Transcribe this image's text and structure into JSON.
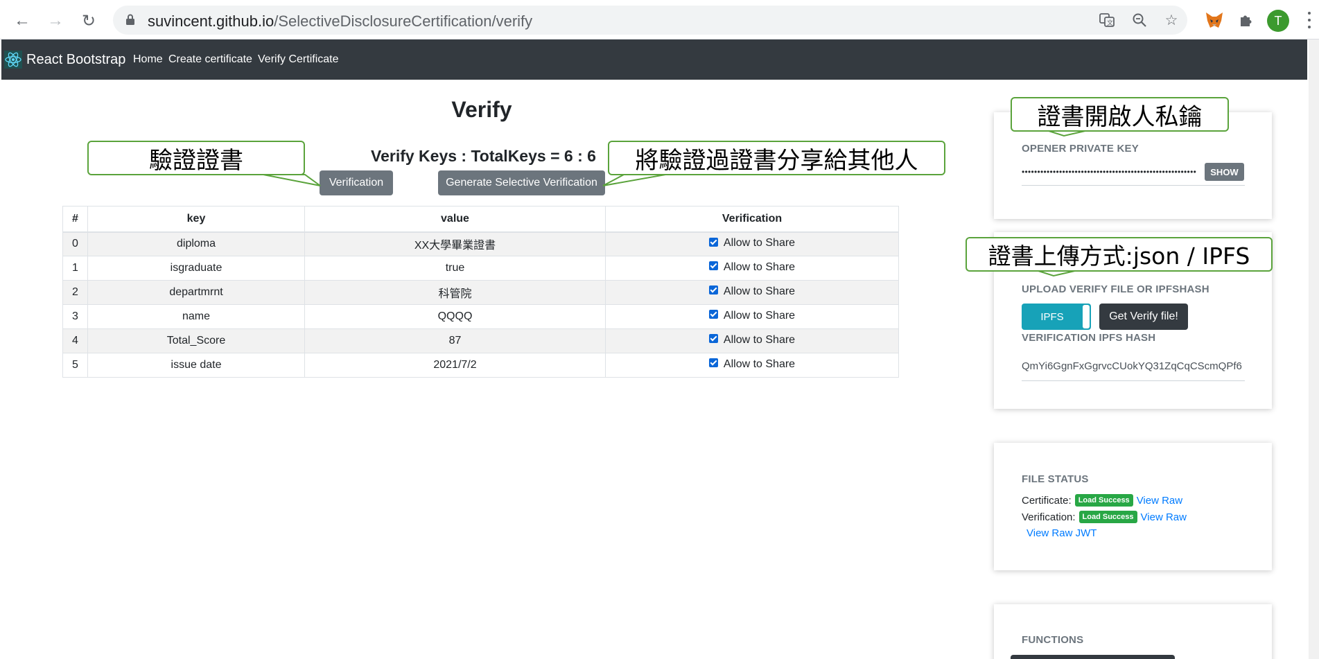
{
  "browser": {
    "url_host": "suvincent.github.io",
    "url_path": "/SelectiveDisclosureCertification/verify",
    "avatar_letter": "T"
  },
  "navbar": {
    "brand": "React Bootstrap",
    "links": [
      "Home",
      "Create certificate",
      "Verify Certificate"
    ]
  },
  "main": {
    "title": "Verify",
    "keys_heading": "Verify Keys : TotalKeys = 6 : 6",
    "verification_button": "Verification",
    "generate_button": "Generate Selective Verification",
    "table": {
      "headers": [
        "#",
        "key",
        "value",
        "Verification"
      ],
      "rows": [
        {
          "index": "0",
          "key": "diploma",
          "value": "XX大學畢業證書",
          "share": "Allow to Share"
        },
        {
          "index": "1",
          "key": "isgraduate",
          "value": "true",
          "share": "Allow to Share"
        },
        {
          "index": "2",
          "key": "departmrnt",
          "value": "科管院",
          "share": "Allow to Share"
        },
        {
          "index": "3",
          "key": "name",
          "value": "QQQQ",
          "share": "Allow to Share"
        },
        {
          "index": "4",
          "key": "Total_Score",
          "value": "87",
          "share": "Allow to Share"
        },
        {
          "index": "5",
          "key": "issue date",
          "value": "2021/7/2",
          "share": "Allow to Share"
        }
      ]
    }
  },
  "sidebar": {
    "private_key": {
      "label": "OPENER PRIVATE KEY",
      "masked_value": "••••••••••••••••••••••••••••••••••••••••••••••••••••••••",
      "show_button": "SHOW"
    },
    "upload": {
      "label": "UPLOAD VERIFY FILE OR IPFSHASH",
      "toggle_label": "IPFS",
      "get_button": "Get Verify file!",
      "hash_label": "VERIFICATION IPFS HASH",
      "hash_value": "QmYi6GgnFxGgrvcCUokYQ31ZqCqCScmQPf6"
    },
    "file_status": {
      "label": "FILE STATUS",
      "certificate_label": "Certificate:",
      "verification_label": "Verification:",
      "badge": "Load Success",
      "view_raw": "View Raw",
      "view_raw_jwt": "View Raw JWT"
    },
    "functions": {
      "label": "FUNCTIONS"
    }
  },
  "annotations": {
    "verify_cert": "驗證證書",
    "share_verified": "將驗證過證書分享給其他人",
    "opener_key": "證書開啟人私鑰",
    "upload_method": "證書上傳方式:json / IPFS"
  },
  "colors": {
    "navbar_bg": "#343a40",
    "secondary_button": "#6c757d",
    "toggle_accent": "#17a2b8",
    "success_badge": "#28a745",
    "link": "#007bff",
    "annotation_border": "#5aa33b"
  }
}
